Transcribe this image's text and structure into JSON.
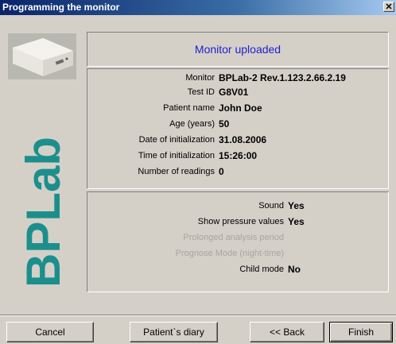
{
  "window": {
    "title": "Programming the monitor",
    "close_glyph": "✕"
  },
  "header": {
    "status": "Monitor uploaded",
    "status_color": "#2020d0"
  },
  "brand": {
    "logo_text": "BPLab",
    "logo_color": "#1c8f8c"
  },
  "info": {
    "rows": [
      {
        "label": "Monitor",
        "value": "BPLab-2 Rev.1.123.2.66.2.19"
      },
      {
        "label": "Test ID",
        "value": "G8V01"
      },
      {
        "label": "Patient name",
        "value": "John Doe"
      },
      {
        "label": "Age (years)",
        "value": "50"
      },
      {
        "label": "Date of initialization",
        "value": "31.08.2006"
      },
      {
        "label": "Time of initialization",
        "value": "15:26:00"
      },
      {
        "label": "Number of readings",
        "value": "0"
      }
    ]
  },
  "settings": {
    "sound": {
      "label": "Sound",
      "value": "Yes"
    },
    "show_pressure": {
      "label": "Show pressure values",
      "value": "Yes"
    },
    "prolonged": {
      "label": "Prolonged analysis period"
    },
    "prognose": {
      "label": "Prognose Mode (night-time)"
    },
    "child_mode": {
      "label": "Child mode",
      "value": "No"
    }
  },
  "buttons": {
    "cancel": "Cancel",
    "diary": "Patient`s diary",
    "back": "<< Back",
    "finish": "Finish"
  },
  "icons": {
    "device": "bp-monitor-device-icon",
    "close": "close-icon"
  }
}
